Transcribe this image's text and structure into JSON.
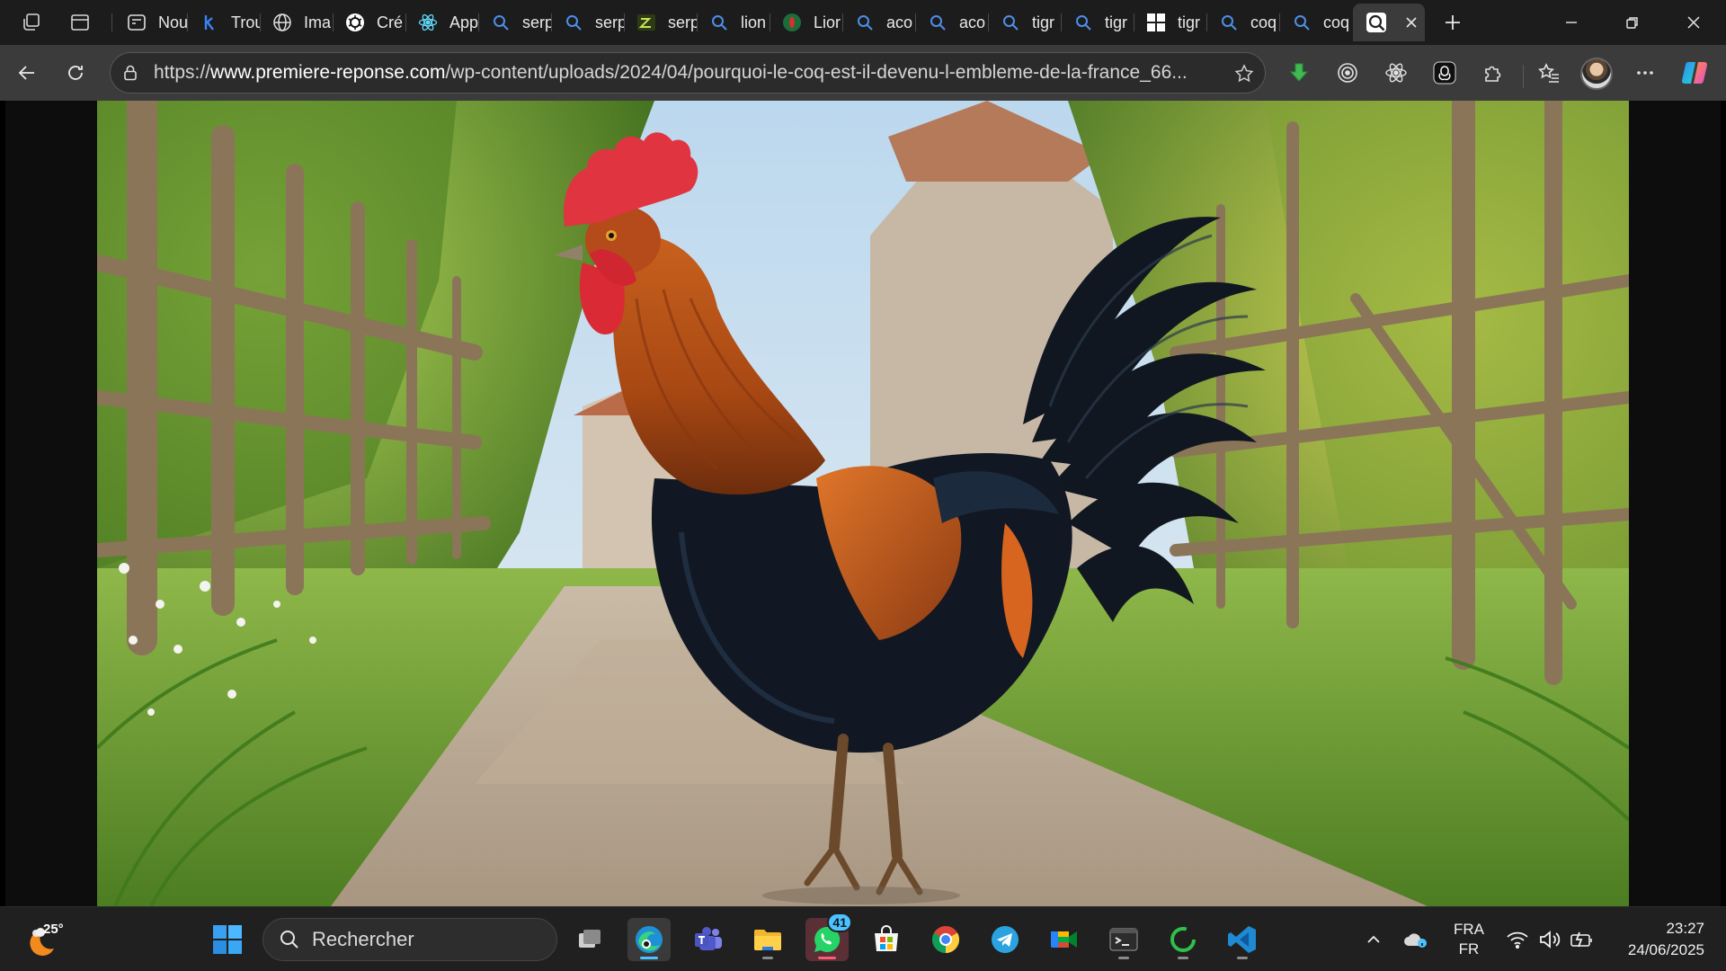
{
  "tabs": [
    {
      "title": "Nou",
      "icon": "new-tab-icon"
    },
    {
      "title": "Trou",
      "icon": "k-logo-icon"
    },
    {
      "title": "Ima",
      "icon": "globe-icon"
    },
    {
      "title": "Cré",
      "icon": "openai-icon"
    },
    {
      "title": "App",
      "icon": "react-icon"
    },
    {
      "title": "serp",
      "icon": "search-icon"
    },
    {
      "title": "serp",
      "icon": "search-icon"
    },
    {
      "title": "serp",
      "icon": "terminal-icon"
    },
    {
      "title": "lion",
      "icon": "search-icon"
    },
    {
      "title": "Lior",
      "icon": "shield-red-green-icon"
    },
    {
      "title": "aco",
      "icon": "search-icon"
    },
    {
      "title": "aco",
      "icon": "search-icon"
    },
    {
      "title": "tigr",
      "icon": "search-icon"
    },
    {
      "title": "tigr",
      "icon": "search-icon"
    },
    {
      "title": "tigr",
      "icon": "windows-grid-icon"
    },
    {
      "title": "coq",
      "icon": "search-icon"
    },
    {
      "title": "coq",
      "icon": "search-icon"
    },
    {
      "title": "",
      "icon": "image-viewer-icon",
      "active": true
    }
  ],
  "address_bar": {
    "scheme": "https://",
    "host": "www.premiere-reponse.com",
    "path": "/wp-content/uploads/2024/04/pourquoi-le-coq-est-il-devenu-l-embleme-de-la-france_66..."
  },
  "taskbar": {
    "weather_temp": "25°",
    "search_label": "Rechercher",
    "whatsapp_badge": "41",
    "lang_line1": "FRA",
    "lang_line2": "FR",
    "time": "23:27",
    "date": "24/06/2025"
  },
  "colors": {
    "accent": "#4cc2ff",
    "tabstrip_bg": "#1c1c1c",
    "toolbar_bg": "#3b3b3b",
    "taskbar_bg": "#202020"
  }
}
